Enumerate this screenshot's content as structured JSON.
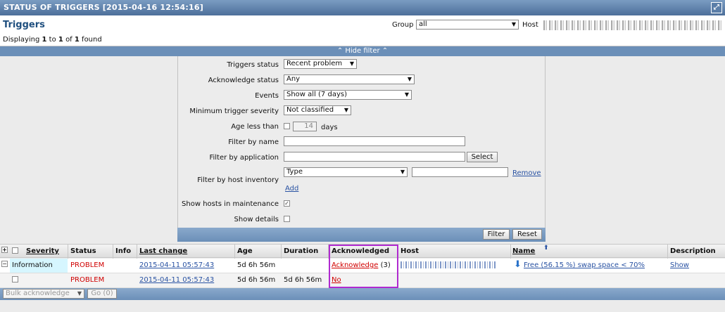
{
  "header": {
    "title": "STATUS OF TRIGGERS [2015-04-16 12:54:16]"
  },
  "page": {
    "heading": "Triggers",
    "display_prefix": "Displaying",
    "display_from": "1",
    "display_to_word": "to",
    "display_to": "1",
    "display_of_word": "of",
    "display_total": "1",
    "display_suffix": "found",
    "group_label": "Group",
    "group_value": "all",
    "host_label": "Host"
  },
  "filter": {
    "toggle_label": "⌃ Hide filter ⌃",
    "triggers_status_label": "Triggers status",
    "triggers_status_value": "Recent problem",
    "ack_status_label": "Acknowledge status",
    "ack_status_value": "Any",
    "events_label": "Events",
    "events_value": "Show all (7 days)",
    "min_severity_label": "Minimum trigger severity",
    "min_severity_value": "Not classified",
    "age_label": "Age less than",
    "age_value": "14",
    "age_unit": "days",
    "filter_name_label": "Filter by name",
    "filter_app_label": "Filter by application",
    "select_button": "Select",
    "filter_inventory_label": "Filter by host inventory",
    "inventory_field_value": "Type",
    "remove_link": "Remove",
    "add_link": "Add",
    "show_maintenance_label": "Show hosts in maintenance",
    "show_details_label": "Show details",
    "filter_button": "Filter",
    "reset_button": "Reset"
  },
  "table": {
    "columns": {
      "severity": "Severity",
      "status": "Status",
      "info": "Info",
      "last_change": "Last change",
      "age": "Age",
      "duration": "Duration",
      "acknowledged": "Acknowledged",
      "host": "Host",
      "name": "Name",
      "description": "Description"
    },
    "rows": [
      {
        "severity": "Information",
        "status": "PROBLEM",
        "last_change": "2015-04-11 05:57:43",
        "age": "5d 6h 56m",
        "duration": "",
        "ack_link": "Acknowledge",
        "ack_count": "(3)",
        "name": "Free (56.15 %) swap space < 70%",
        "description": "Show"
      },
      {
        "severity": "",
        "status": "PROBLEM",
        "last_change": "2015-04-11 05:57:43",
        "age": "5d 6h 56m",
        "duration": "5d 6h 56m",
        "ack_link": "No"
      }
    ]
  },
  "footer": {
    "bulk_action": "Bulk acknowledge",
    "go_button": "Go (0)"
  },
  "colors": {
    "titlebar": "#5b7ea8",
    "problem": "#d00000",
    "info_severity_bg": "#d6f6ff",
    "highlight_box": "#b02ad0",
    "link": "#2a53a3"
  }
}
